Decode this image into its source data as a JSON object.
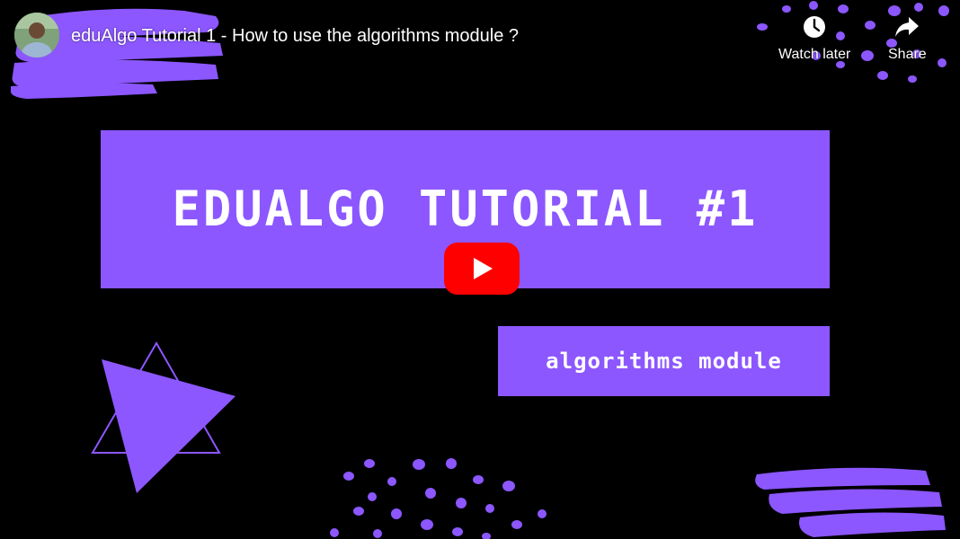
{
  "player": {
    "title": "eduAlgo Tutorial 1 - How to use the algorithms module ?",
    "watch_later_label": "Watch later",
    "share_label": "Share"
  },
  "thumbnail": {
    "heading": "EDUALGO TUTORIAL #1",
    "subheading": "algorithms module"
  },
  "colors": {
    "accent": "#8c57ff",
    "play_red": "#ff0000",
    "background": "#000000"
  },
  "icons": {
    "watch_later": "clock-icon",
    "share": "share-arrow-icon",
    "play": "play-icon"
  }
}
